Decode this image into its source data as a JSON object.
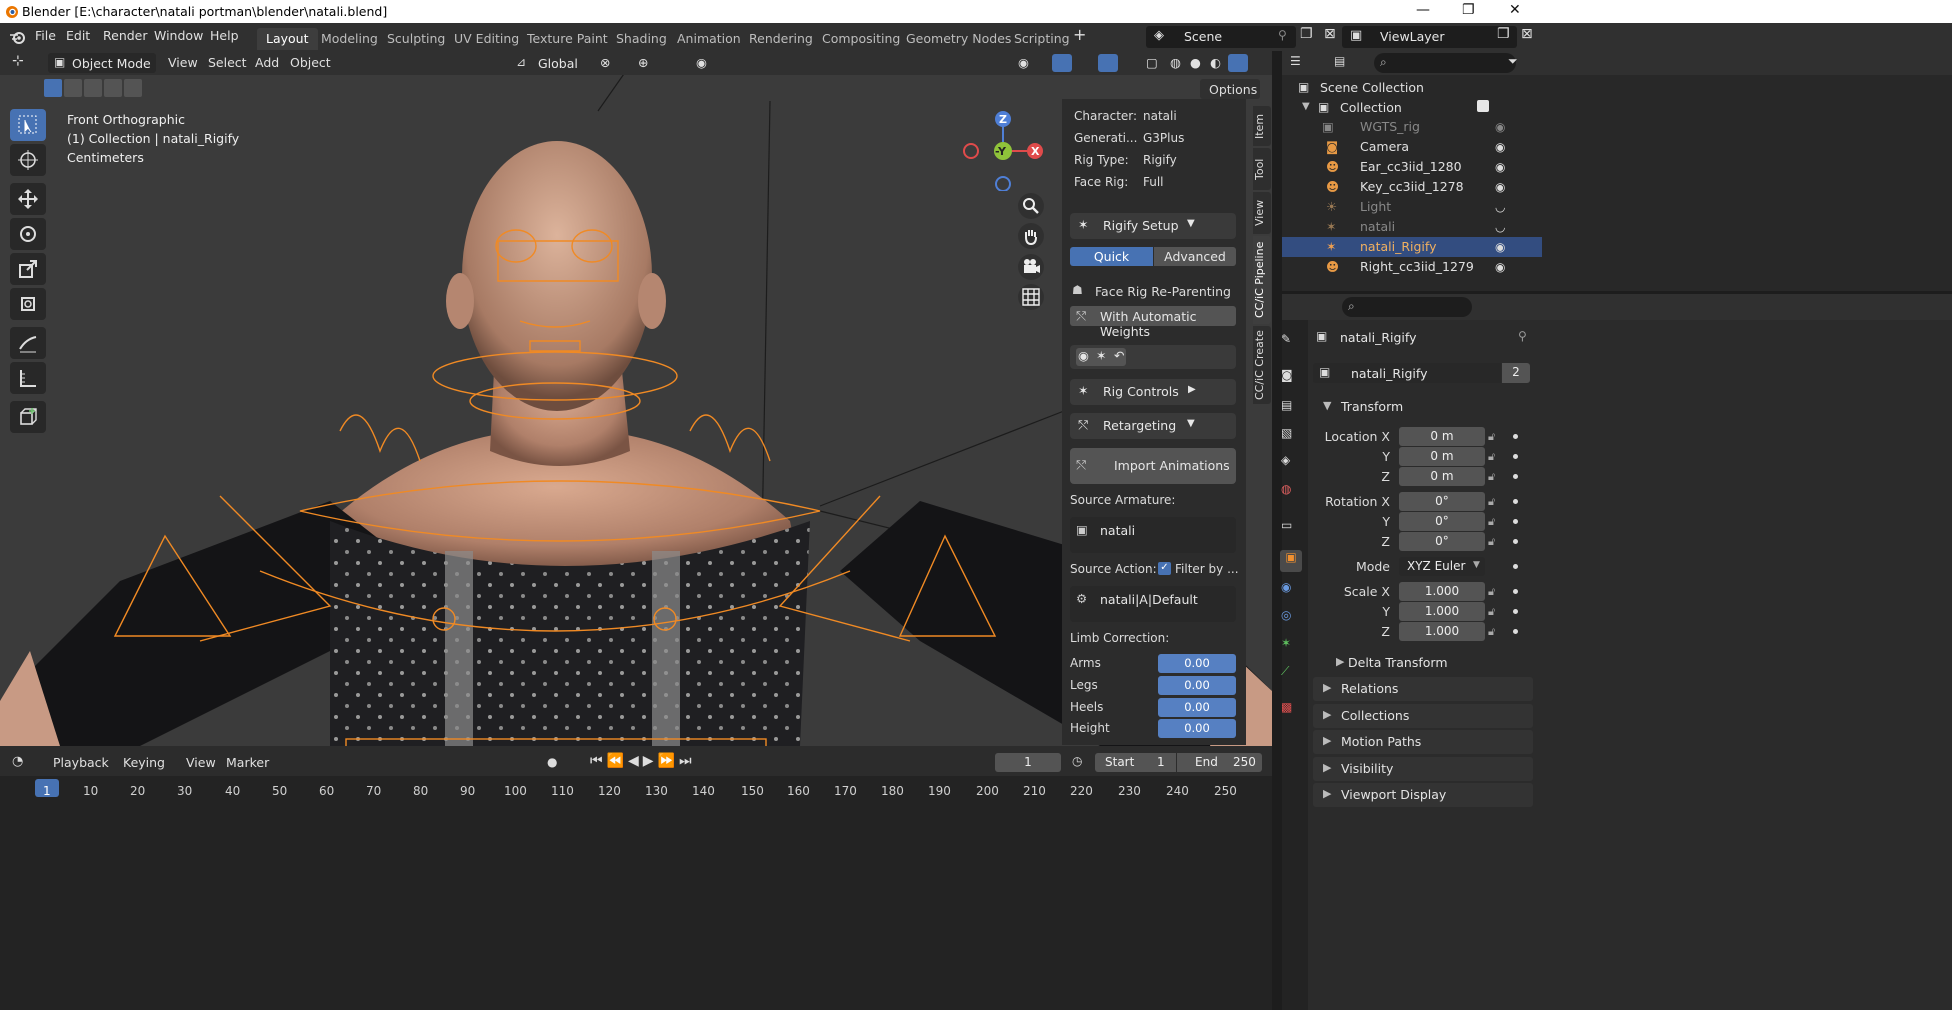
{
  "title_bar": {
    "title": "Blender [E:\\character\\natali portman\\blender\\natali.blend]"
  },
  "menu": [
    "File",
    "Edit",
    "Render",
    "Window",
    "Help"
  ],
  "workspaces": [
    "Layout",
    "Modeling",
    "Sculpting",
    "UV Editing",
    "Texture Paint",
    "Shading",
    "Animation",
    "Rendering",
    "Compositing",
    "Geometry Nodes",
    "Scripting"
  ],
  "scene": {
    "name": "Scene",
    "view_layer": "ViewLayer"
  },
  "viewport": {
    "mode": "Object Mode",
    "menus": [
      "View",
      "Select",
      "Add",
      "Object"
    ],
    "orientation": "Global",
    "options_label": "Options",
    "overlay_text": {
      "line1": "Front Orthographic",
      "line2": "(1) Collection | natali_Rigify",
      "line3": "Centimeters"
    },
    "gizmo": {
      "z": "Z",
      "y": "-Y",
      "x": "X"
    }
  },
  "n_panel": {
    "info": [
      {
        "k": "Character:",
        "v": "natali"
      },
      {
        "k": "Generati...",
        "v": "G3Plus"
      },
      {
        "k": "Rig Type:",
        "v": "Rigify"
      },
      {
        "k": "Face Rig:",
        "v": "Full"
      }
    ],
    "rigify_setup": "Rigify Setup",
    "tabs": [
      "Quick",
      "Advanced"
    ],
    "face_rig_reparenting": "Face Rig Re-Parenting",
    "auto_weights": "With Automatic Weights",
    "rig_controls": "Rig Controls",
    "retargeting": "Retargeting",
    "import_animations": "Import Animations",
    "source_armature_label": "Source Armature:",
    "source_armature": "natali",
    "source_action_label": "Source Action:",
    "filter_by": "Filter by ...",
    "source_action": "natali|A|Default",
    "limb_correction_label": "Limb Correction:",
    "limbs": [
      {
        "k": "Arms",
        "v": "0.00"
      },
      {
        "k": "Legs",
        "v": "0.00"
      },
      {
        "k": "Heels",
        "v": "0.00"
      },
      {
        "k": "Height",
        "v": "0.00"
      }
    ],
    "side_tabs": [
      "Item",
      "Tool",
      "View",
      "CC/iC Pipeline",
      "CC/iC Create"
    ]
  },
  "timeline": {
    "menus": [
      "Playback",
      "Keying",
      "View",
      "Marker"
    ],
    "current_frame": "1",
    "start_label": "Start",
    "start": "1",
    "end_label": "End",
    "end": "250",
    "frames": [
      "1",
      "10",
      "20",
      "30",
      "40",
      "50",
      "60",
      "70",
      "80",
      "90",
      "100",
      "110",
      "120",
      "130",
      "140",
      "150",
      "160",
      "170",
      "180",
      "190",
      "200",
      "210",
      "220",
      "230",
      "240",
      "250"
    ]
  },
  "outliner": {
    "scene_collection": "Scene Collection",
    "collection": "Collection",
    "items": [
      "WGTS_rig",
      "Camera",
      "Ear_cc3iid_1280",
      "Key_cc3iid_1278",
      "Light",
      "natali",
      "natali_Rigify",
      "Right_cc3iid_1279"
    ]
  },
  "properties": {
    "object_name": "natali_Rigify",
    "data_name": "natali_Rigify",
    "users": "2",
    "transform_label": "Transform",
    "location": [
      {
        "k": "Location X",
        "v": "0 m"
      },
      {
        "k": "Y",
        "v": "0 m"
      },
      {
        "k": "Z",
        "v": "0 m"
      }
    ],
    "rotation": [
      {
        "k": "Rotation X",
        "v": "0°"
      },
      {
        "k": "Y",
        "v": "0°"
      },
      {
        "k": "Z",
        "v": "0°"
      }
    ],
    "mode_label": "Mode",
    "mode": "XYZ Euler",
    "scale": [
      {
        "k": "Scale X",
        "v": "1.000"
      },
      {
        "k": "Y",
        "v": "1.000"
      },
      {
        "k": "Z",
        "v": "1.000"
      }
    ],
    "sections": [
      "Delta Transform",
      "Relations",
      "Collections",
      "Motion Paths",
      "Visibility",
      "Viewport Display"
    ]
  },
  "colors": {
    "accent": "#4772b3",
    "selection": "#334d80",
    "rig": "#f08a24",
    "viewport_bg": "#3b3b3b"
  }
}
